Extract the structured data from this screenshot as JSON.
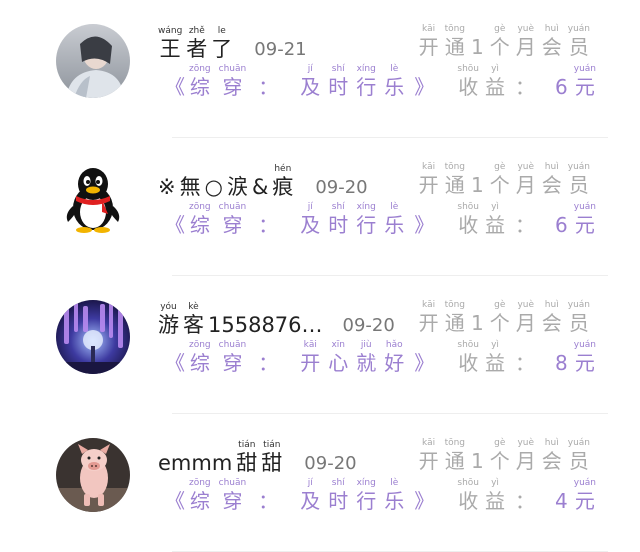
{
  "rows": [
    {
      "avatar": "avatar-person-photo",
      "name": [
        {
          "py": "wáng",
          "ch": "王"
        },
        {
          "py": "zhě",
          "ch": "者"
        },
        {
          "py": "le",
          "ch": "了"
        }
      ],
      "name_plain": "",
      "date": "09-21",
      "tag_open": "《",
      "tag_label": [
        {
          "py": "zōng",
          "ch": "综"
        },
        {
          "py": "chuān",
          "ch": "穿"
        }
      ],
      "tag_colon": "：",
      "tag_value": [
        {
          "py": "jí",
          "ch": "及"
        },
        {
          "py": "shí",
          "ch": "时"
        },
        {
          "py": "xíng",
          "ch": "行"
        },
        {
          "py": "lè",
          "ch": "乐"
        }
      ],
      "tag_close": "》",
      "status": [
        {
          "py": "kāi",
          "ch": "开"
        },
        {
          "py": "tōng",
          "ch": "通"
        },
        {
          "py": "",
          "ch": "1"
        },
        {
          "py": "gè",
          "ch": "个"
        },
        {
          "py": "yuè",
          "ch": "月"
        },
        {
          "py": "huì",
          "ch": "会"
        },
        {
          "py": "yuán",
          "ch": "员"
        }
      ],
      "earn_label": [
        {
          "py": "shōu",
          "ch": "收"
        },
        {
          "py": "yì",
          "ch": "益"
        }
      ],
      "earn_colon": "：",
      "earn_amount": "6",
      "earn_unit": {
        "py": "yuán",
        "ch": "元"
      }
    },
    {
      "avatar": "qq-penguin-icon",
      "name": [
        {
          "py": "",
          "ch": "※"
        },
        {
          "py": "",
          "ch": "無"
        },
        {
          "py": "",
          "ch": "○"
        },
        {
          "py": "",
          "ch": "涙"
        },
        {
          "py": "",
          "ch": "&"
        },
        {
          "py": "hén",
          "ch": "痕"
        }
      ],
      "name_plain": "",
      "date": "09-20",
      "tag_open": "《",
      "tag_label": [
        {
          "py": "zōng",
          "ch": "综"
        },
        {
          "py": "chuān",
          "ch": "穿"
        }
      ],
      "tag_colon": "：",
      "tag_value": [
        {
          "py": "jí",
          "ch": "及"
        },
        {
          "py": "shí",
          "ch": "时"
        },
        {
          "py": "xíng",
          "ch": "行"
        },
        {
          "py": "lè",
          "ch": "乐"
        }
      ],
      "tag_close": "》",
      "status": [
        {
          "py": "kāi",
          "ch": "开"
        },
        {
          "py": "tōng",
          "ch": "通"
        },
        {
          "py": "",
          "ch": "1"
        },
        {
          "py": "gè",
          "ch": "个"
        },
        {
          "py": "yuè",
          "ch": "月"
        },
        {
          "py": "huì",
          "ch": "会"
        },
        {
          "py": "yuán",
          "ch": "员"
        }
      ],
      "earn_label": [
        {
          "py": "shōu",
          "ch": "收"
        },
        {
          "py": "yì",
          "ch": "益"
        }
      ],
      "earn_colon": "：",
      "earn_amount": "6",
      "earn_unit": {
        "py": "yuán",
        "ch": "元"
      }
    },
    {
      "avatar": "avatar-wisteria-photo",
      "name": [
        {
          "py": "yóu",
          "ch": "游"
        },
        {
          "py": "kè",
          "ch": "客"
        }
      ],
      "name_plain": "1558876…",
      "date": "09-20",
      "tag_open": "《",
      "tag_label": [
        {
          "py": "zōng",
          "ch": "综"
        },
        {
          "py": "chuān",
          "ch": "穿"
        }
      ],
      "tag_colon": "：",
      "tag_value": [
        {
          "py": "kāi",
          "ch": "开"
        },
        {
          "py": "xīn",
          "ch": "心"
        },
        {
          "py": "jiù",
          "ch": "就"
        },
        {
          "py": "hǎo",
          "ch": "好"
        }
      ],
      "tag_close": "》",
      "status": [
        {
          "py": "kāi",
          "ch": "开"
        },
        {
          "py": "tōng",
          "ch": "通"
        },
        {
          "py": "",
          "ch": "1"
        },
        {
          "py": "gè",
          "ch": "个"
        },
        {
          "py": "yuè",
          "ch": "月"
        },
        {
          "py": "huì",
          "ch": "会"
        },
        {
          "py": "yuán",
          "ch": "员"
        }
      ],
      "earn_label": [
        {
          "py": "shōu",
          "ch": "收"
        },
        {
          "py": "yì",
          "ch": "益"
        }
      ],
      "earn_colon": "：",
      "earn_amount": "8",
      "earn_unit": {
        "py": "yuán",
        "ch": "元"
      }
    },
    {
      "avatar": "avatar-pig-photo",
      "name": [
        {
          "py": "",
          "ch": "emmm"
        },
        {
          "py": "tián",
          "ch": "甜"
        },
        {
          "py": "tián",
          "ch": "甜"
        }
      ],
      "name_plain": "",
      "date": "09-20",
      "tag_open": "《",
      "tag_label": [
        {
          "py": "zōng",
          "ch": "综"
        },
        {
          "py": "chuān",
          "ch": "穿"
        }
      ],
      "tag_colon": "：",
      "tag_value": [
        {
          "py": "jí",
          "ch": "及"
        },
        {
          "py": "shí",
          "ch": "时"
        },
        {
          "py": "xíng",
          "ch": "行"
        },
        {
          "py": "lè",
          "ch": "乐"
        }
      ],
      "tag_close": "》",
      "status": [
        {
          "py": "kāi",
          "ch": "开"
        },
        {
          "py": "tōng",
          "ch": "通"
        },
        {
          "py": "",
          "ch": "1"
        },
        {
          "py": "gè",
          "ch": "个"
        },
        {
          "py": "yuè",
          "ch": "月"
        },
        {
          "py": "huì",
          "ch": "会"
        },
        {
          "py": "yuán",
          "ch": "员"
        }
      ],
      "earn_label": [
        {
          "py": "shōu",
          "ch": "收"
        },
        {
          "py": "yì",
          "ch": "益"
        }
      ],
      "earn_colon": "：",
      "earn_amount": "4",
      "earn_unit": {
        "py": "yuán",
        "ch": "元"
      }
    }
  ],
  "colors": {
    "accent": "#9b7fd0",
    "muted": "#aaaaaa",
    "text": "#222222",
    "divider": "#eeeeee"
  }
}
